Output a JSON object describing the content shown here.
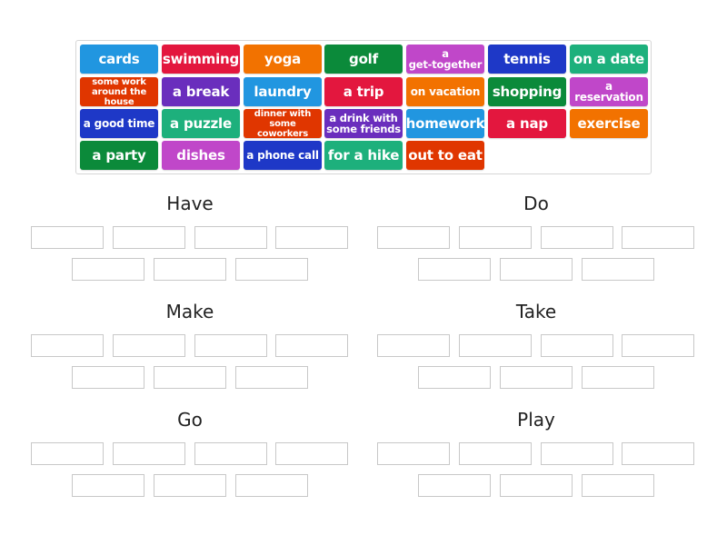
{
  "colors": {
    "blue": "#2196e0",
    "red": "#e3173e",
    "orange": "#f27200",
    "green": "#0b8a3a",
    "magenta": "#c047c9",
    "navy": "#1e38c7",
    "teal": "#1db07c",
    "redorange": "#e03600",
    "purple": "#6a2ebd"
  },
  "tiles": [
    {
      "label": "cards",
      "color": "blue"
    },
    {
      "label": "swimming",
      "color": "red"
    },
    {
      "label": "yoga",
      "color": "orange"
    },
    {
      "label": "golf",
      "color": "green"
    },
    {
      "label": "a get-together",
      "color": "magenta"
    },
    {
      "label": "tennis",
      "color": "navy"
    },
    {
      "label": "on a date",
      "color": "teal"
    },
    {
      "label": "some work around the house",
      "color": "redorange"
    },
    {
      "label": "a break",
      "color": "purple"
    },
    {
      "label": "laundry",
      "color": "blue"
    },
    {
      "label": "a trip",
      "color": "red"
    },
    {
      "label": "on vacation",
      "color": "orange"
    },
    {
      "label": "shopping",
      "color": "green"
    },
    {
      "label": "a reservation",
      "color": "magenta"
    },
    {
      "label": "a good time",
      "color": "navy"
    },
    {
      "label": "a puzzle",
      "color": "teal"
    },
    {
      "label": "dinner with some coworkers",
      "color": "redorange"
    },
    {
      "label": "a drink with some friends",
      "color": "purple"
    },
    {
      "label": "homework",
      "color": "blue"
    },
    {
      "label": "a nap",
      "color": "red"
    },
    {
      "label": "exercise",
      "color": "orange"
    },
    {
      "label": "a party",
      "color": "green"
    },
    {
      "label": "dishes",
      "color": "magenta"
    },
    {
      "label": "a phone call",
      "color": "navy"
    },
    {
      "label": "for a hike",
      "color": "teal"
    },
    {
      "label": "out to eat",
      "color": "redorange"
    }
  ],
  "categories": [
    {
      "title": "Have",
      "slots": 7
    },
    {
      "title": "Do",
      "slots": 7
    },
    {
      "title": "Make",
      "slots": 7
    },
    {
      "title": "Take",
      "slots": 7
    },
    {
      "title": "Go",
      "slots": 7
    },
    {
      "title": "Play",
      "slots": 7
    }
  ]
}
